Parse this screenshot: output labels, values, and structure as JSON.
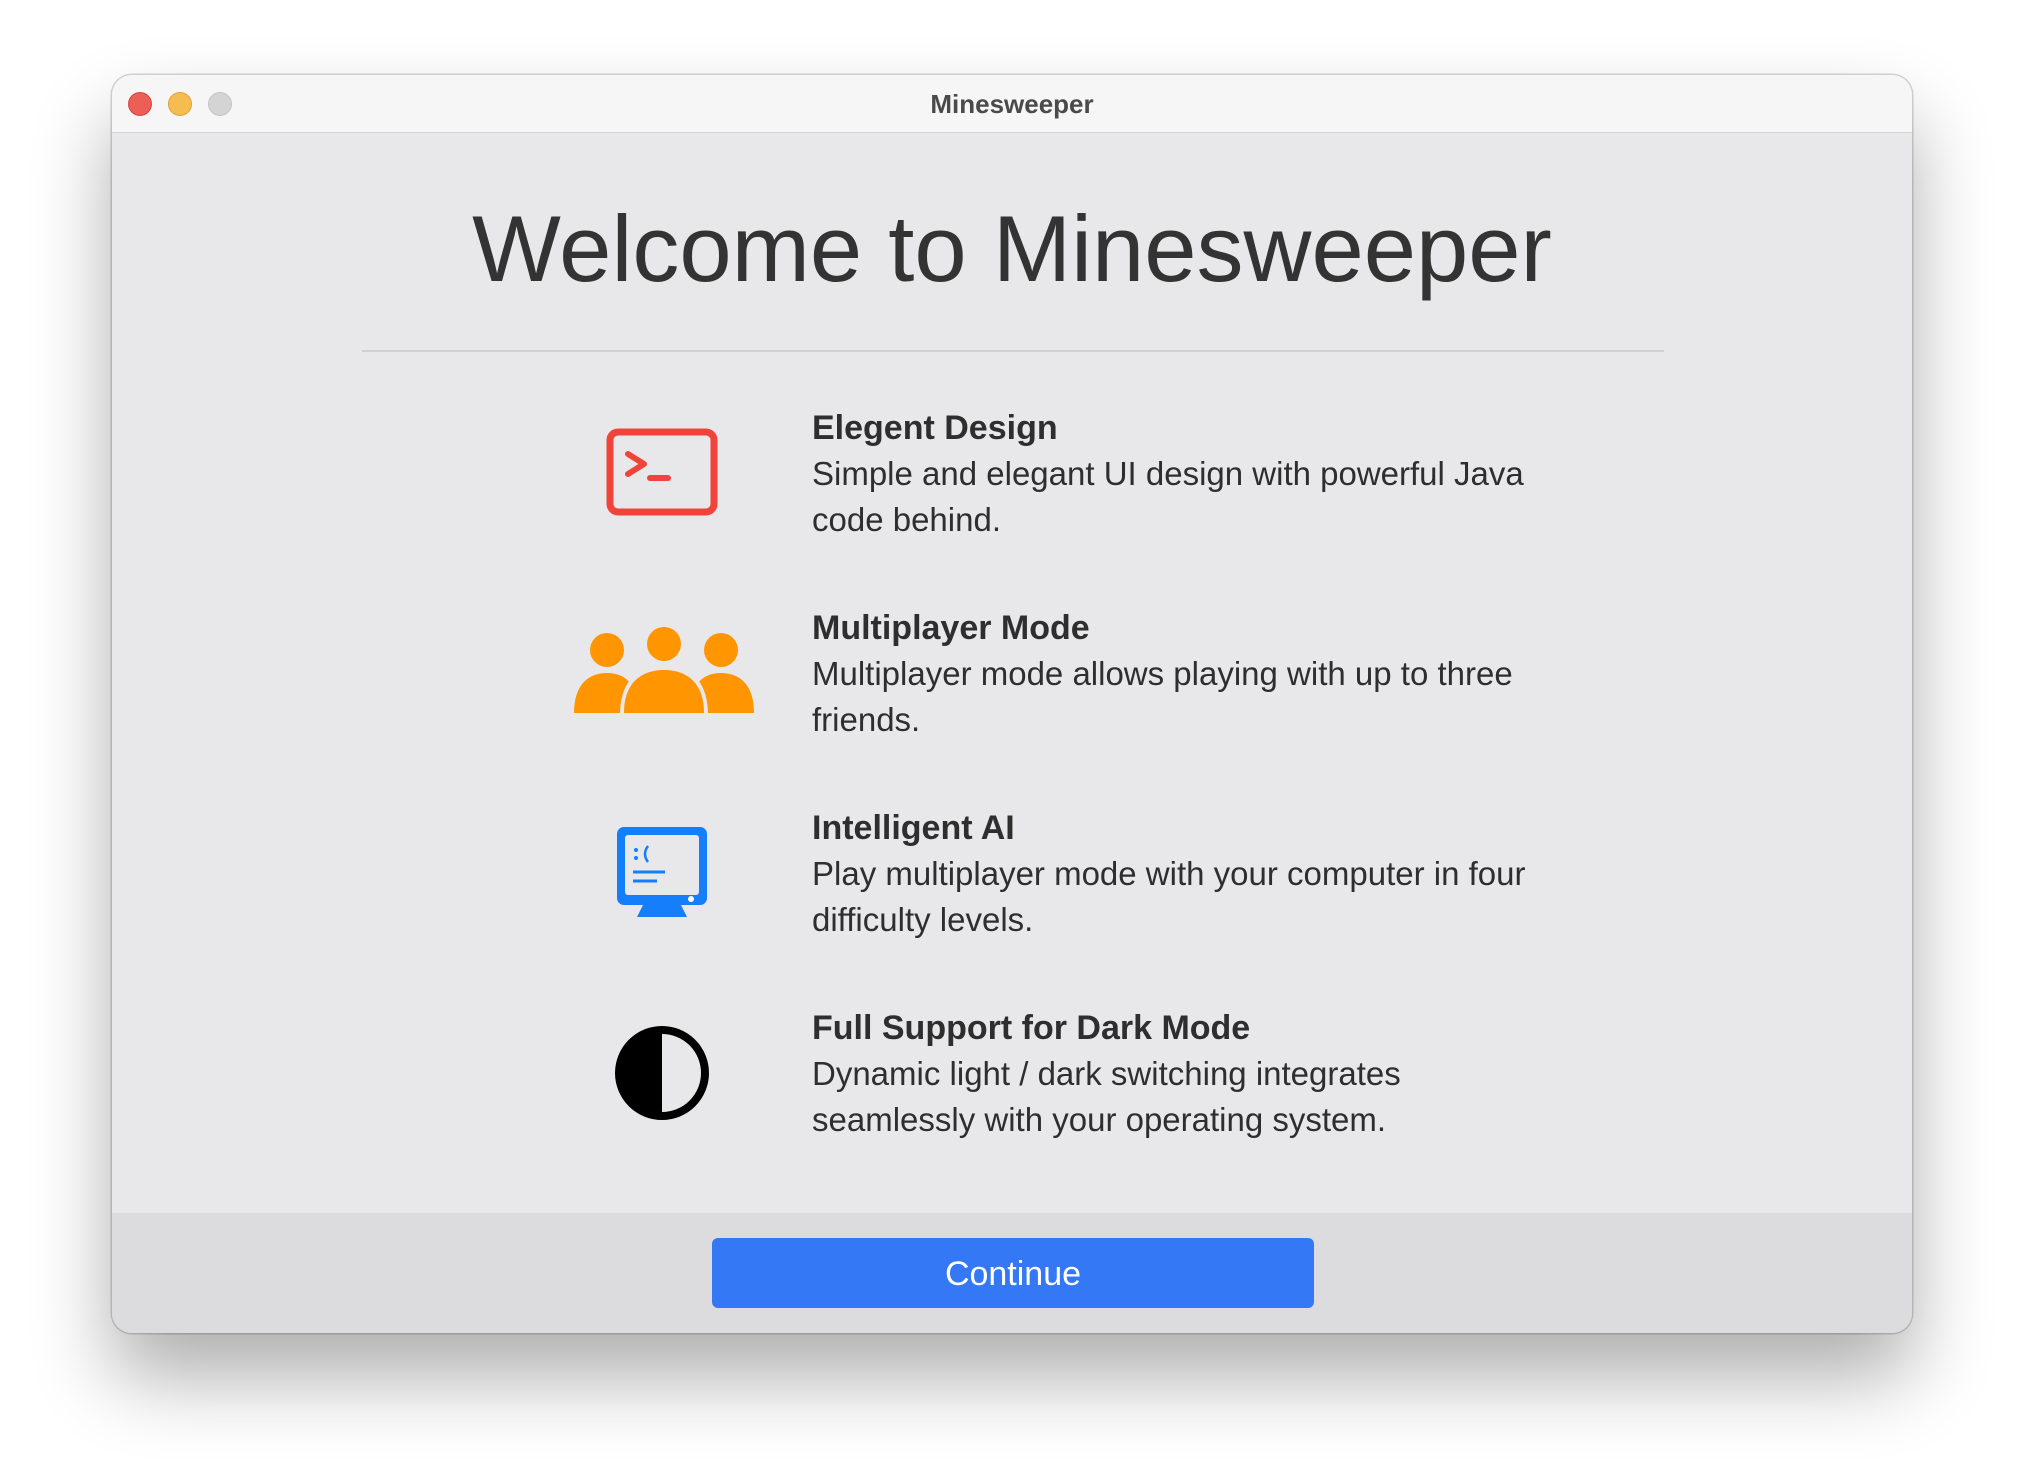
{
  "window": {
    "title": "Minesweeper"
  },
  "main": {
    "heading": "Welcome to Minesweeper"
  },
  "features": [
    {
      "icon": "terminal-icon",
      "title": "Elegent Design",
      "description": "Simple and elegant UI design with powerful Java code behind."
    },
    {
      "icon": "people-group-icon",
      "title": "Multiplayer Mode",
      "description": "Multiplayer mode allows playing with up to three friends."
    },
    {
      "icon": "computer-monitor-icon",
      "title": "Intelligent AI",
      "description": "Play multiplayer mode with your computer in four difficulty levels."
    },
    {
      "icon": "half-circle-contrast-icon",
      "title": "Full Support for Dark Mode",
      "description": "Dynamic light / dark switching integrates seamlessly with your operating system."
    }
  ],
  "footer": {
    "continue_label": "Continue"
  },
  "colors": {
    "accent": "#3478f6",
    "terminal_icon": "#f0443a",
    "people_icon": "#ff9500",
    "computer_icon": "#147efb",
    "contrast_icon": "#000000"
  }
}
